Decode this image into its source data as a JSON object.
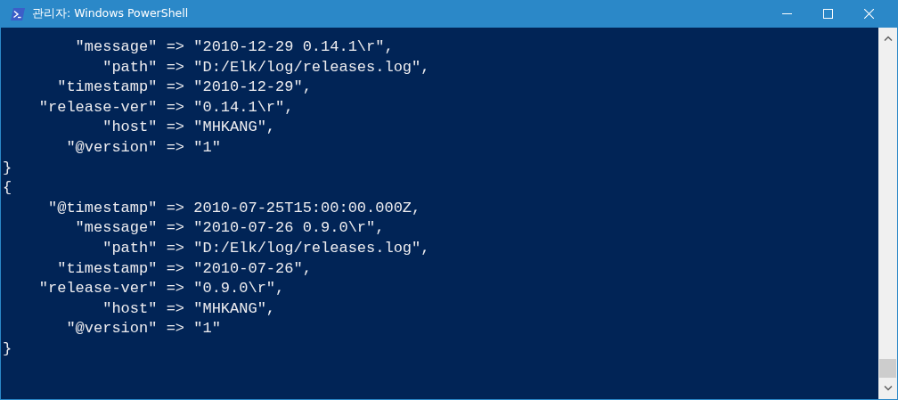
{
  "window": {
    "title": "관리자: Windows PowerShell"
  },
  "console": {
    "lines": [
      "        \"message\" => \"2010-12-29 0.14.1\\r\",",
      "           \"path\" => \"D:/Elk/log/releases.log\",",
      "      \"timestamp\" => \"2010-12-29\",",
      "    \"release-ver\" => \"0.14.1\\r\",",
      "           \"host\" => \"MHKANG\",",
      "       \"@version\" => \"1\"",
      "}",
      "{",
      "     \"@timestamp\" => 2010-07-25T15:00:00.000Z,",
      "        \"message\" => \"2010-07-26 0.9.0\\r\",",
      "           \"path\" => \"D:/Elk/log/releases.log\",",
      "      \"timestamp\" => \"2010-07-26\",",
      "    \"release-ver\" => \"0.9.0\\r\",",
      "           \"host\" => \"MHKANG\",",
      "       \"@version\" => \"1\"",
      "}"
    ]
  }
}
